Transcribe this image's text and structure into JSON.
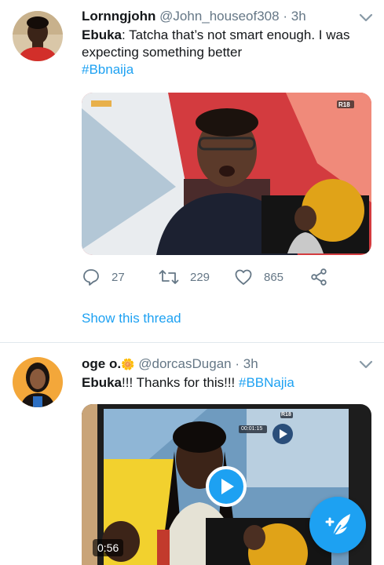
{
  "tweets": [
    {
      "author_name": "Lornngjohn",
      "handle": "@John_houseof308",
      "separator": "·",
      "time": "3h",
      "body_bold": "Ebuka",
      "body_text": ": Tatcha that’s not smart enough. I was expecting something better",
      "hashtag": "#Bbnaija",
      "video_badge": "R18",
      "reply_count": "27",
      "retweet_count": "229",
      "like_count": "865",
      "show_thread": "Show this thread"
    },
    {
      "author_name": "oge o.",
      "name_emoji": "🌼",
      "handle": "@dorcasDugan",
      "separator": "·",
      "time": "3h",
      "body_bold": "Ebuka",
      "body_text": "!!! Thanks for this!!! ",
      "hashtag": "#BBNajia",
      "video_badge": "R18",
      "timer": "00:01:15",
      "duration": "0:56"
    }
  ],
  "icons": {
    "more": "chevron-down-icon",
    "reply": "reply-icon",
    "retweet": "retweet-icon",
    "like": "heart-icon",
    "share": "share-icon",
    "play": "play-icon",
    "compose": "compose-tweet-icon"
  },
  "colors": {
    "link": "#1da1f2",
    "secondary_text": "#657786",
    "divider": "#e1e8ed",
    "fab": "#1da1f2"
  }
}
